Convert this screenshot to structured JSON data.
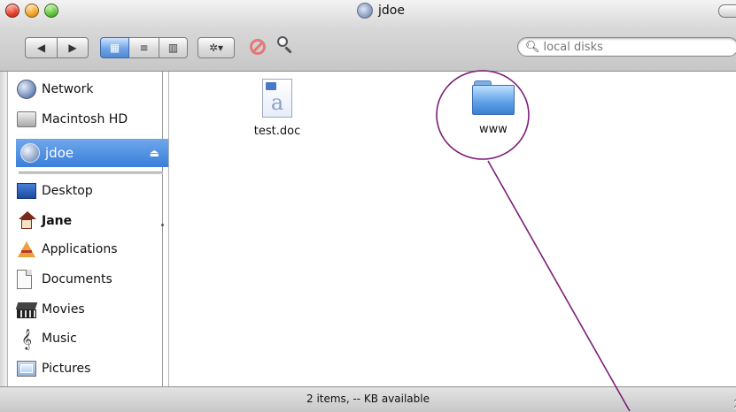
{
  "window": {
    "title": "jdoe",
    "title_icon": "home-folder-icon",
    "traffic_lights": [
      "close",
      "minimize",
      "zoom"
    ]
  },
  "toolbar": {
    "back_label": "◀",
    "forward_label": "▶",
    "view_icon_label": "▦",
    "view_list_label": "≡",
    "view_column_label": "▥",
    "action_label": "✲▾",
    "search": {
      "placeholder": "local disks",
      "value": ""
    }
  },
  "sidebar": {
    "devices": [
      {
        "label": "Network",
        "icon": "network-icon"
      },
      {
        "label": "Macintosh HD",
        "icon": "hard-drive-icon"
      },
      {
        "label": "jdoe",
        "icon": "idisk-icon",
        "selected": true,
        "eject_label": "⏏"
      }
    ],
    "places": [
      {
        "label": "Desktop",
        "icon": "desktop-icon"
      },
      {
        "label": "Jane",
        "icon": "home-icon",
        "bold": true
      },
      {
        "label": "Applications",
        "icon": "applications-icon"
      },
      {
        "label": "Documents",
        "icon": "documents-icon"
      },
      {
        "label": "Movies",
        "icon": "movies-icon"
      },
      {
        "label": "Music",
        "icon": "music-icon"
      },
      {
        "label": "Pictures",
        "icon": "pictures-icon"
      }
    ]
  },
  "content": {
    "items": [
      {
        "label": "test.doc",
        "icon": "word-document-icon"
      },
      {
        "label": "www",
        "icon": "folder-icon"
      }
    ]
  },
  "status": {
    "text": "2 items, -- KB available"
  },
  "annotation": {
    "color": "#7a1f7a",
    "shape": "circle-with-pointer-line"
  }
}
